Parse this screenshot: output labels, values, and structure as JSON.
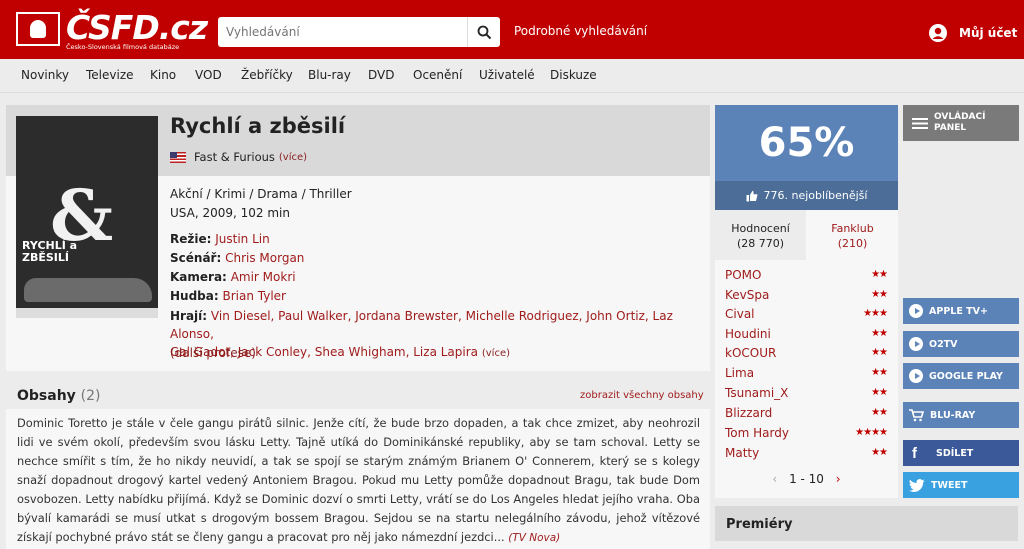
{
  "header": {
    "logo_text": "ČSFD.cz",
    "logo_sub": "Česko-Slovenská filmová databáze",
    "search_placeholder": "Vyhledávání",
    "advanced_search": "Podrobné vyhledávání",
    "account": "Můj účet"
  },
  "nav": [
    "Novinky",
    "Televize",
    "Kino",
    "VOD",
    "Žebříčky",
    "Blu-ray",
    "DVD",
    "Ocenění",
    "Uživatelé",
    "Diskuze"
  ],
  "film": {
    "title": "Rychlí a zběsilí",
    "original_title": "Fast & Furious",
    "more": "(více)",
    "genres": "Akční / Krimi / Drama / Thriller",
    "origin": "USA, 2009, 102 min",
    "directing_label": "Režie:",
    "directing": "Justin Lin",
    "screenplay_label": "Scénář:",
    "screenplay": "Chris Morgan",
    "camera_label": "Kamera:",
    "camera": "Amir Mokri",
    "music_label": "Hudba:",
    "music": "Brian Tyler",
    "cast_label": "Hrají:",
    "cast_line1": "Vin Diesel, Paul Walker, Jordana Brewster, Michelle Rodriguez, John Ortiz, Laz Alonso,",
    "cast_line2": "Gal Gadot, Jack Conley, Shea Whigham, Liza Lapira",
    "cast_more": "(více)",
    "more_professions": "(další profese)",
    "poster_text_1": "RYCHLÍ a",
    "poster_text_2": "ZBĚSILÍ"
  },
  "plot": {
    "title": "Obsahy",
    "count": "(2)",
    "show_all": "zobrazit všechny obsahy",
    "text": "Dominic Toretto je stále v čele gangu pirátů silnic. Jenže cítí, že bude brzo dopaden, a tak chce zmizet, aby neohrozil lidi ve svém okolí, především svou lásku Letty. Tajně utíká do Dominikánské republiky, aby se tam schoval. Letty se nechce smířit s tím, že ho nikdy neuvidí, a tak se spojí se starým známým Brianem O' Connerem, který se s kolegy snaží dopadnout drogový kartel vedený Antoniem Bragou. Pokud mu Letty pomůže dopadnout Bragu, tak bude Dom osvobozen. Letty nabídku přijímá. Když se Dominic dozví o smrti Letty, vrátí se do Los Angeles hledat jejího vraha. Oba bývalí kamarádi se musí utkat s drogovým bossem Bragou. Sejdou se na startu nelegálního závodu, jehož vítězové získají pochybné právo stát se členy gangu a pracovat pro něj jako námezdní jezdci...",
    "source": "(TV Nova)"
  },
  "rating": {
    "percent": "65%",
    "rank": "776. nejoblíbenější",
    "tab_ratings": "Hodnocení",
    "tab_ratings_count": "(28 770)",
    "tab_fanclub": "Fanklub",
    "tab_fanclub_count": "(210)",
    "raters": [
      {
        "name": "POMO",
        "stars": "★★"
      },
      {
        "name": "KevSpa",
        "stars": "★★"
      },
      {
        "name": "Cival",
        "stars": "★★★"
      },
      {
        "name": "Houdini",
        "stars": "★★"
      },
      {
        "name": "kOCOUR",
        "stars": "★★"
      },
      {
        "name": "Lima",
        "stars": "★★"
      },
      {
        "name": "Tsunami_X",
        "stars": "★★"
      },
      {
        "name": "Blizzard",
        "stars": "★★"
      },
      {
        "name": "Tom Hardy",
        "stars": "★★★★"
      },
      {
        "name": "Matty",
        "stars": "★★"
      }
    ],
    "pager": "1 - 10"
  },
  "sidebar": {
    "control_panel": "OVLÁDACÍ PANEL",
    "apple_tv": "APPLE TV+",
    "o2tv": "O2TV",
    "google_play": "GOOGLE PLAY",
    "bluray": "BLU-RAY",
    "share": "SDÍLET",
    "tweet": "TWEET"
  },
  "premiery": "Premiéry",
  "colors": {
    "brand": "#c00000",
    "rating_blue": "#5b83b7",
    "facebook": "#3b5998",
    "twitter": "#3aa1e0"
  }
}
